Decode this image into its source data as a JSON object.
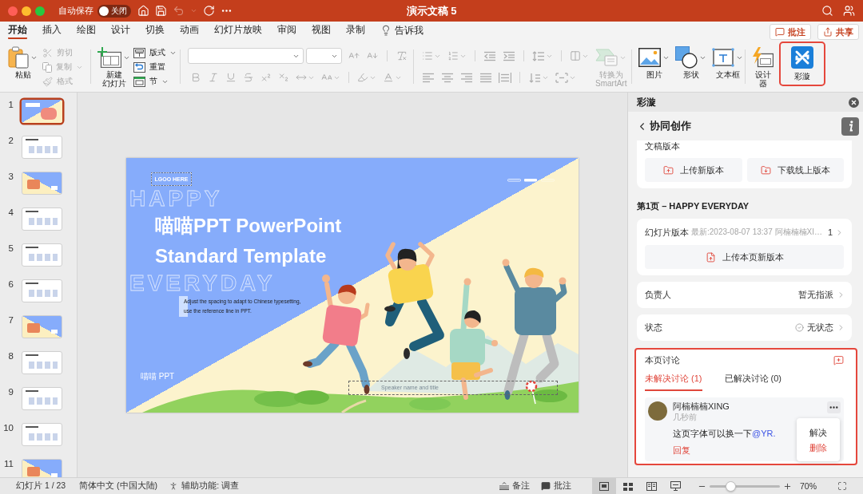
{
  "window": {
    "title": "演示文稿 5",
    "autosave": {
      "label": "自动保存",
      "on": false,
      "state_label": "关闭"
    },
    "undo": {
      "disabled": true
    }
  },
  "tabs": [
    {
      "label": "开始",
      "selected": true
    },
    {
      "label": "插入",
      "selected": false
    },
    {
      "label": "绘图",
      "selected": false
    },
    {
      "label": "设计",
      "selected": false
    },
    {
      "label": "切换",
      "selected": false
    },
    {
      "label": "动画",
      "selected": false
    },
    {
      "label": "幻灯片放映",
      "selected": false
    },
    {
      "label": "审阅",
      "selected": false
    },
    {
      "label": "视图",
      "selected": false
    },
    {
      "label": "录制",
      "selected": false
    }
  ],
  "tell_me": {
    "label": "告诉我"
  },
  "header_buttons": [
    {
      "label": "批注"
    },
    {
      "label": "共享"
    }
  ],
  "ribbon": {
    "paste": {
      "label": "粘贴"
    },
    "clipboard_items": [
      {
        "label": "剪切",
        "disabled": true,
        "dropdown": false
      },
      {
        "label": "复制",
        "disabled": true,
        "dropdown": true
      },
      {
        "label": "格式",
        "disabled": true,
        "dropdown": false
      }
    ],
    "new_slide": {
      "label_lines": [
        "新建",
        "幻灯片"
      ]
    },
    "slide_items": [
      {
        "label": "版式",
        "dropdown": true
      },
      {
        "label": "重置",
        "dropdown": false
      },
      {
        "label": "节",
        "dropdown": true
      }
    ],
    "formatting": {
      "disabled": true
    },
    "smartart": {
      "label_lines": [
        "转换为",
        "SmartArt"
      ],
      "disabled": true
    },
    "insert_items": [
      {
        "label": "图片",
        "dropdown": true
      },
      {
        "label": "形状",
        "dropdown": true
      },
      {
        "label": "文本框",
        "dropdown": true
      }
    ],
    "designer": {
      "label_lines": [
        "设计",
        "器"
      ]
    },
    "addin": {
      "label": "彩漩",
      "highlighted": true
    }
  },
  "thumbnails": [
    {
      "number": "1",
      "kind": "cover",
      "selected": true
    },
    {
      "number": "2",
      "kind": "content",
      "selected": false
    },
    {
      "number": "3",
      "kind": "section",
      "selected": false
    },
    {
      "number": "4",
      "kind": "content",
      "selected": false
    },
    {
      "number": "5",
      "kind": "content",
      "selected": false
    },
    {
      "number": "6",
      "kind": "content",
      "selected": false
    },
    {
      "number": "7",
      "kind": "section",
      "selected": false
    },
    {
      "number": "8",
      "kind": "content",
      "selected": false
    },
    {
      "number": "9",
      "kind": "content",
      "selected": false
    },
    {
      "number": "10",
      "kind": "content",
      "selected": false
    },
    {
      "number": "11",
      "kind": "section",
      "selected": false
    }
  ],
  "slide": {
    "logo": "LGOO HERE",
    "background_words": [
      "HAPPY",
      "EVERYDAY"
    ],
    "title_lines": [
      "喵喵PPT PowerPoint",
      "Standard Template"
    ],
    "subtitle_lines": [
      "Adjust the spacing to adapt to Chinese  typesetting,",
      "use the reference line in PPT."
    ],
    "brand": "喵喵 PPT",
    "speaker": "Speaker name and title"
  },
  "side_panel": {
    "title": "彩漩",
    "back_label": "协同创作",
    "versions": {
      "title": "文稿版本",
      "buttons": [
        {
          "label": "上传新版本"
        },
        {
          "label": "下载线上版本"
        }
      ]
    },
    "page_heading": "第1页 – HAPPY EVERYDAY",
    "slide_version": {
      "label": "幻灯片版本",
      "detail": "最新:2023-08-07 13:37 阿楠楠楠XI…",
      "count": "1",
      "button": "上传本页新版本"
    },
    "rows": [
      {
        "label": "负责人",
        "value": "暂无指派",
        "kind": "plain"
      },
      {
        "label": "状态",
        "value": "无状态",
        "kind": "status"
      }
    ],
    "discussion": {
      "title": "本页讨论",
      "highlighted": true,
      "tabs": [
        {
          "label": "未解决讨论 (1)",
          "selected": true
        },
        {
          "label": "已解决讨论 (0)",
          "selected": false
        }
      ],
      "comments": [
        {
          "author": "阿楠楠楠XING",
          "time": "几秒前",
          "text": "这页字体可以换一下",
          "mention": "@YR.",
          "reply": "回复"
        }
      ],
      "menu": [
        {
          "label": "解决",
          "kind": "normal"
        },
        {
          "label": "删除",
          "kind": "danger"
        }
      ]
    }
  },
  "status_bar": {
    "slide_position": "幻灯片 1 / 23",
    "language": "简体中文 (中国大陆)",
    "accessibility": "辅助功能: 调查",
    "notes": "备注",
    "comments": "批注",
    "views": [
      {
        "selected": true
      },
      {
        "selected": false
      },
      {
        "selected": false
      },
      {
        "selected": false
      }
    ],
    "zoom": {
      "level": 0.3,
      "reading": "70%"
    }
  }
}
